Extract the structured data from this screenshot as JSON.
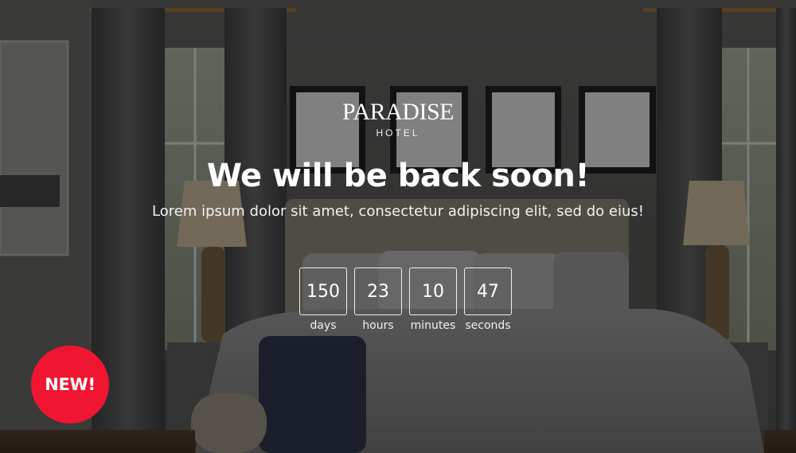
{
  "logo": {
    "name": "PARADISE",
    "sub": "HOTEL"
  },
  "headline": "We will be back soon!",
  "subline": "Lorem ipsum dolor sit amet, consectetur adipiscing elit, sed do eius!",
  "countdown": [
    {
      "value": "150",
      "label": "days"
    },
    {
      "value": "23",
      "label": "hours"
    },
    {
      "value": "10",
      "label": "minutes"
    },
    {
      "value": "47",
      "label": "seconds"
    }
  ],
  "badge": {
    "label": "NEW!"
  },
  "colors": {
    "badge": "#f01632",
    "overlay": "rgba(0,0,0,0.38)"
  }
}
